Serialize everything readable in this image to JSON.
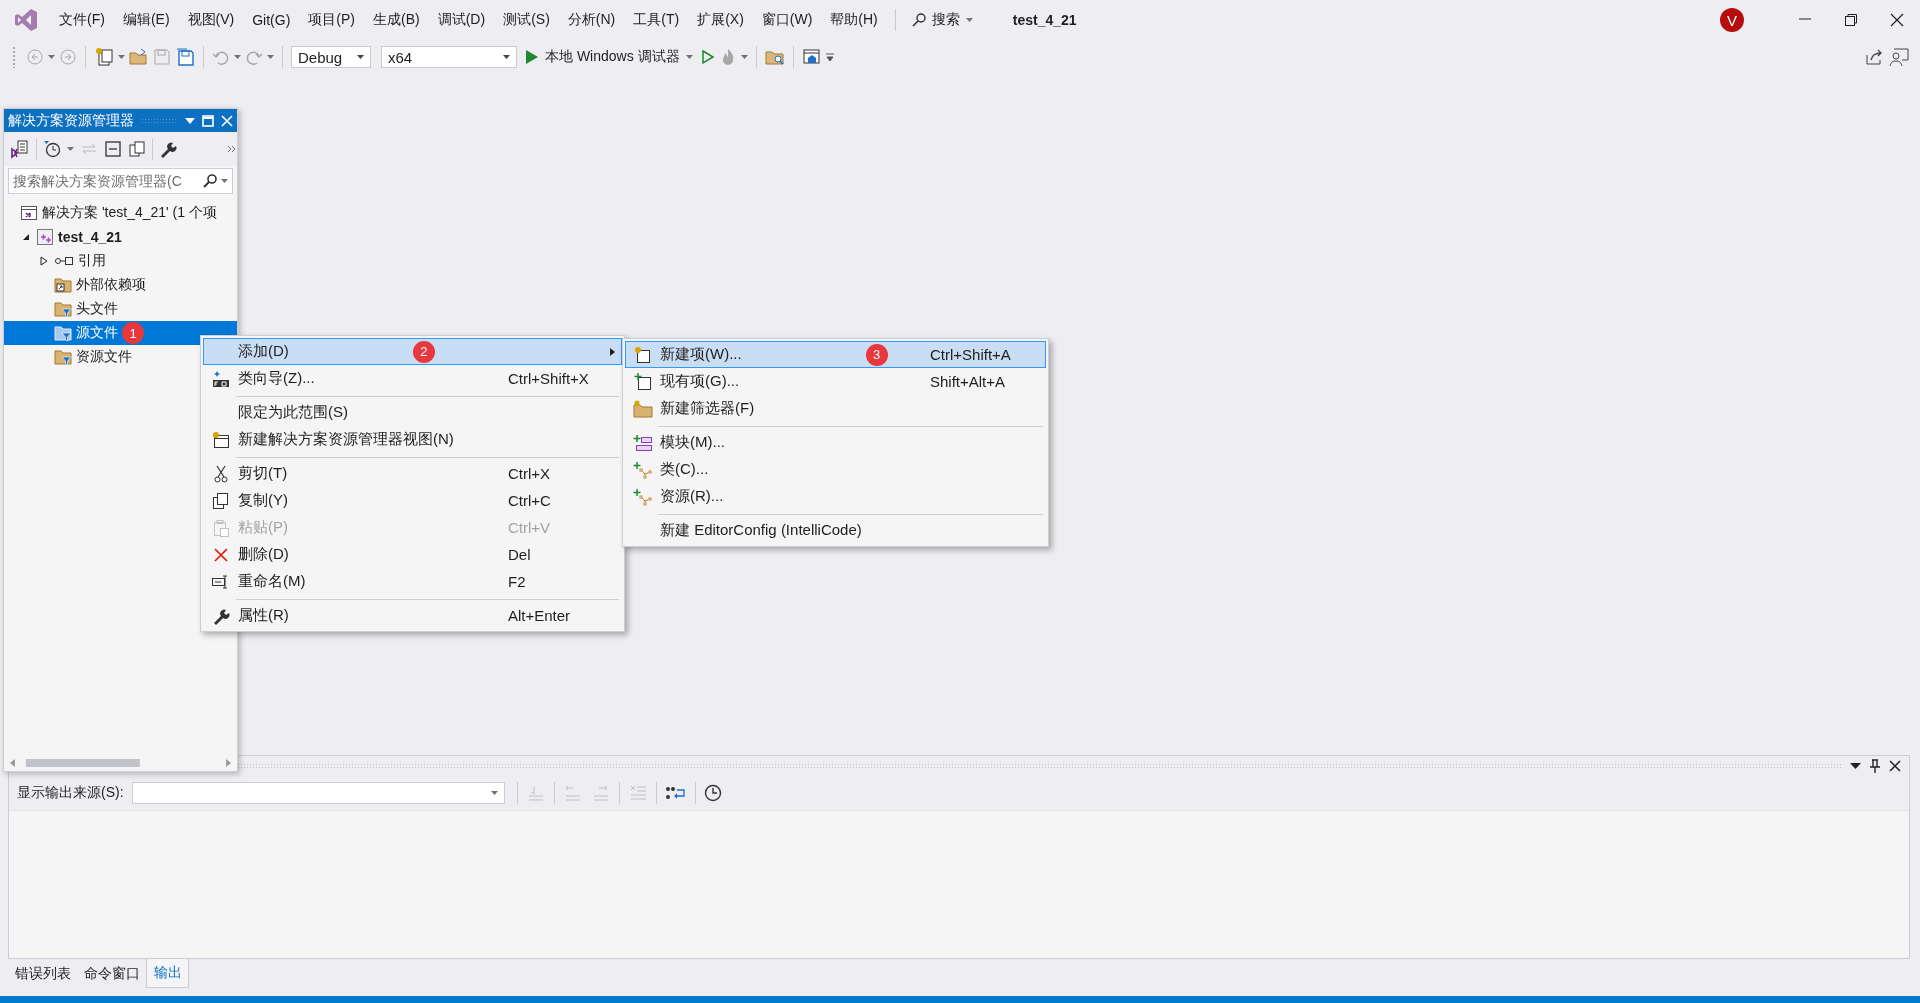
{
  "title_bar": {
    "menus": [
      "文件(F)",
      "编辑(E)",
      "视图(V)",
      "Git(G)",
      "项目(P)",
      "生成(B)",
      "调试(D)",
      "测试(S)",
      "分析(N)",
      "工具(T)",
      "扩展(X)",
      "窗口(W)",
      "帮助(H)"
    ],
    "search": "搜索",
    "solution_name": "test_4_21",
    "avatar": "V"
  },
  "toolbar": {
    "configuration": "Debug",
    "platform": "x64",
    "debugger": "本地 Windows 调试器"
  },
  "solution_explorer": {
    "title": "解决方案资源管理器",
    "search": {
      "placeholder": "搜索解决方案资源管理器(C"
    },
    "tree": [
      {
        "label": "解决方案 'test_4_21' (1 个项",
        "kind": "solution",
        "selected": false,
        "children": [
          {
            "label": "test_4_21",
            "kind": "project",
            "expanded": true,
            "selected": false,
            "children": [
              {
                "label": "引用",
                "kind": "references",
                "expanded": false,
                "selected": false
              },
              {
                "label": "外部依赖项",
                "kind": "external",
                "selected": false
              },
              {
                "label": "头文件",
                "kind": "filter",
                "selected": false
              },
              {
                "label": "源文件",
                "kind": "filter",
                "selected": true,
                "annotation": "1"
              },
              {
                "label": "资源文件",
                "kind": "filter",
                "selected": false
              }
            ]
          }
        ]
      }
    ]
  },
  "context_menu": {
    "items": [
      {
        "label": "添加(D)",
        "selected": true,
        "disabled": false,
        "has_submenu": true,
        "separator_above": false,
        "annotation": "2"
      },
      {
        "label": "类向导(Z)...",
        "shortcut": "Ctrl+Shift+X",
        "selected": false,
        "disabled": false,
        "has_submenu": false,
        "separator_above": false
      },
      {
        "label": "限定为此范围(S)",
        "selected": false,
        "disabled": false,
        "has_submenu": false,
        "separator_above": true
      },
      {
        "label": "新建解决方案资源管理器视图(N)",
        "selected": false,
        "disabled": false,
        "has_submenu": false,
        "separator_above": false
      },
      {
        "label": "剪切(T)",
        "shortcut": "Ctrl+X",
        "selected": false,
        "disabled": false,
        "has_submenu": false,
        "separator_above": true
      },
      {
        "label": "复制(Y)",
        "shortcut": "Ctrl+C",
        "selected": false,
        "disabled": false,
        "has_submenu": false,
        "separator_above": false
      },
      {
        "label": "粘贴(P)",
        "shortcut": "Ctrl+V",
        "selected": false,
        "disabled": true,
        "has_submenu": false,
        "separator_above": false
      },
      {
        "label": "删除(D)",
        "shortcut": "Del",
        "selected": false,
        "disabled": false,
        "has_submenu": false,
        "separator_above": false
      },
      {
        "label": "重命名(M)",
        "shortcut": "F2",
        "selected": false,
        "disabled": false,
        "has_submenu": false,
        "separator_above": false
      },
      {
        "label": "属性(R)",
        "shortcut": "Alt+Enter",
        "selected": false,
        "disabled": false,
        "has_submenu": false,
        "separator_above": true
      }
    ]
  },
  "submenu": {
    "items": [
      {
        "label": "新建项(W)...",
        "shortcut": "Ctrl+Shift+A",
        "selected": true,
        "separator_above": false,
        "annotation": "3"
      },
      {
        "label": "现有项(G)...",
        "shortcut": "Shift+Alt+A",
        "selected": false,
        "separator_above": false
      },
      {
        "label": "新建筛选器(F)",
        "selected": false,
        "separator_above": false
      },
      {
        "label": "模块(M)...",
        "selected": false,
        "separator_above": true
      },
      {
        "label": "类(C)...",
        "selected": false,
        "separator_above": false
      },
      {
        "label": "资源(R)...",
        "selected": false,
        "separator_above": false
      },
      {
        "label": "新建 EditorConfig (IntelliCode)",
        "selected": false,
        "separator_above": true
      }
    ]
  },
  "output": {
    "source_label": "显示输出来源(S):"
  },
  "bottom_tabs": [
    {
      "label": "错误列表",
      "selected": false
    },
    {
      "label": "命令窗口",
      "selected": false
    },
    {
      "label": "输出",
      "selected": true
    }
  ]
}
